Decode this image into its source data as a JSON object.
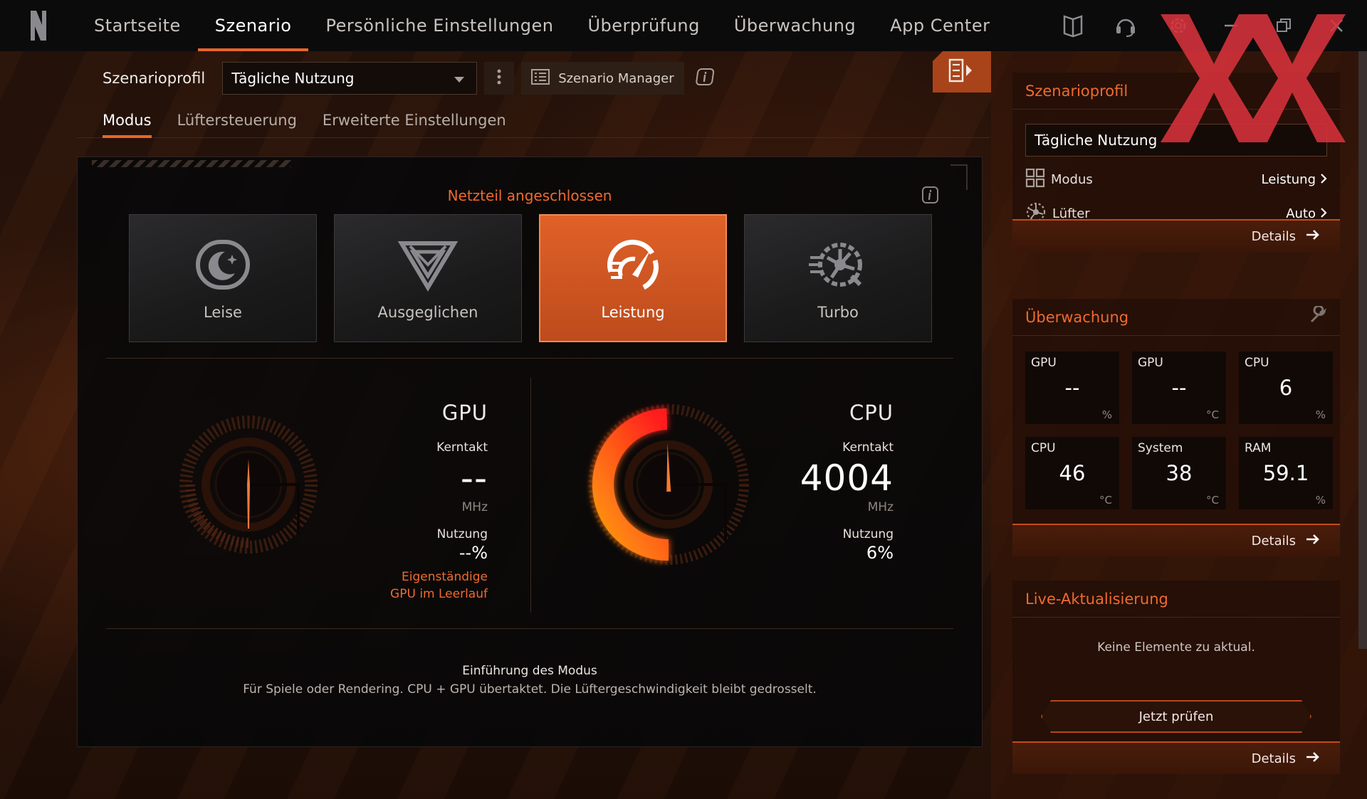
{
  "nav": {
    "items": [
      "Startseite",
      "Szenario",
      "Persönliche Einstellungen",
      "Überprüfung",
      "Überwachung",
      "App Center"
    ],
    "active_index": 1
  },
  "profile": {
    "label": "Szenarioprofil",
    "selected": "Tägliche Nutzung",
    "manager_label": "Szenario Manager"
  },
  "subtabs": [
    "Modus",
    "Lüftersteuerung",
    "Erweiterte Einstellungen"
  ],
  "mode_card": {
    "power_status": "Netzteil angeschlossen",
    "modes": [
      {
        "label": "Leise",
        "icon": "moon-icon",
        "active": false
      },
      {
        "label": "Ausgeglichen",
        "icon": "triangle-icon",
        "active": false
      },
      {
        "label": "Leistung",
        "icon": "speedometer-icon",
        "active": true
      },
      {
        "label": "Turbo",
        "icon": "turbo-fan-icon",
        "active": false
      }
    ]
  },
  "gpu": {
    "title": "GPU",
    "clock_label": "Kerntakt",
    "clock_value": "--",
    "clock_unit": "MHz",
    "usage_label": "Nutzung",
    "usage_value": "--%",
    "warning": "Eigenständige GPU im Leerlauf",
    "usage_fraction": 0
  },
  "cpu": {
    "title": "CPU",
    "clock_label": "Kerntakt",
    "clock_value": "4004",
    "clock_unit": "MHz",
    "usage_label": "Nutzung",
    "usage_value": "6%",
    "gauge_fraction": 0.62
  },
  "intro": {
    "title": "Einführung des Modus",
    "text": "Für Spiele oder Rendering. CPU + GPU übertaktet. Die Lüftergeschwindigkeit bleibt gedrosselt."
  },
  "side_profile": {
    "title": "Szenarioprofil",
    "selected": "Tägliche Nutzung",
    "rows": [
      {
        "label": "Modus",
        "value": "Leistung",
        "icon": "grid-icon"
      },
      {
        "label": "Lüfter",
        "value": "Auto",
        "icon": "fan-icon"
      }
    ],
    "details": "Details"
  },
  "side_monitor": {
    "title": "Überwachung",
    "tiles": [
      {
        "label": "GPU",
        "value": "--",
        "unit": "%"
      },
      {
        "label": "GPU",
        "value": "--",
        "unit": "°C"
      },
      {
        "label": "CPU",
        "value": "6",
        "unit": "%"
      },
      {
        "label": "CPU",
        "value": "46",
        "unit": "°C"
      },
      {
        "label": "System",
        "value": "38",
        "unit": "°C"
      },
      {
        "label": "RAM",
        "value": "59.1",
        "unit": "%"
      }
    ],
    "details": "Details"
  },
  "side_live": {
    "title": "Live-Aktualisierung",
    "empty": "Keine Elemente zu aktual.",
    "button": "Jetzt prüfen",
    "details": "Details"
  },
  "colors": {
    "accent": "#e8662a",
    "accent_text": "#ee6b2e",
    "watermark": "#d8323c"
  }
}
